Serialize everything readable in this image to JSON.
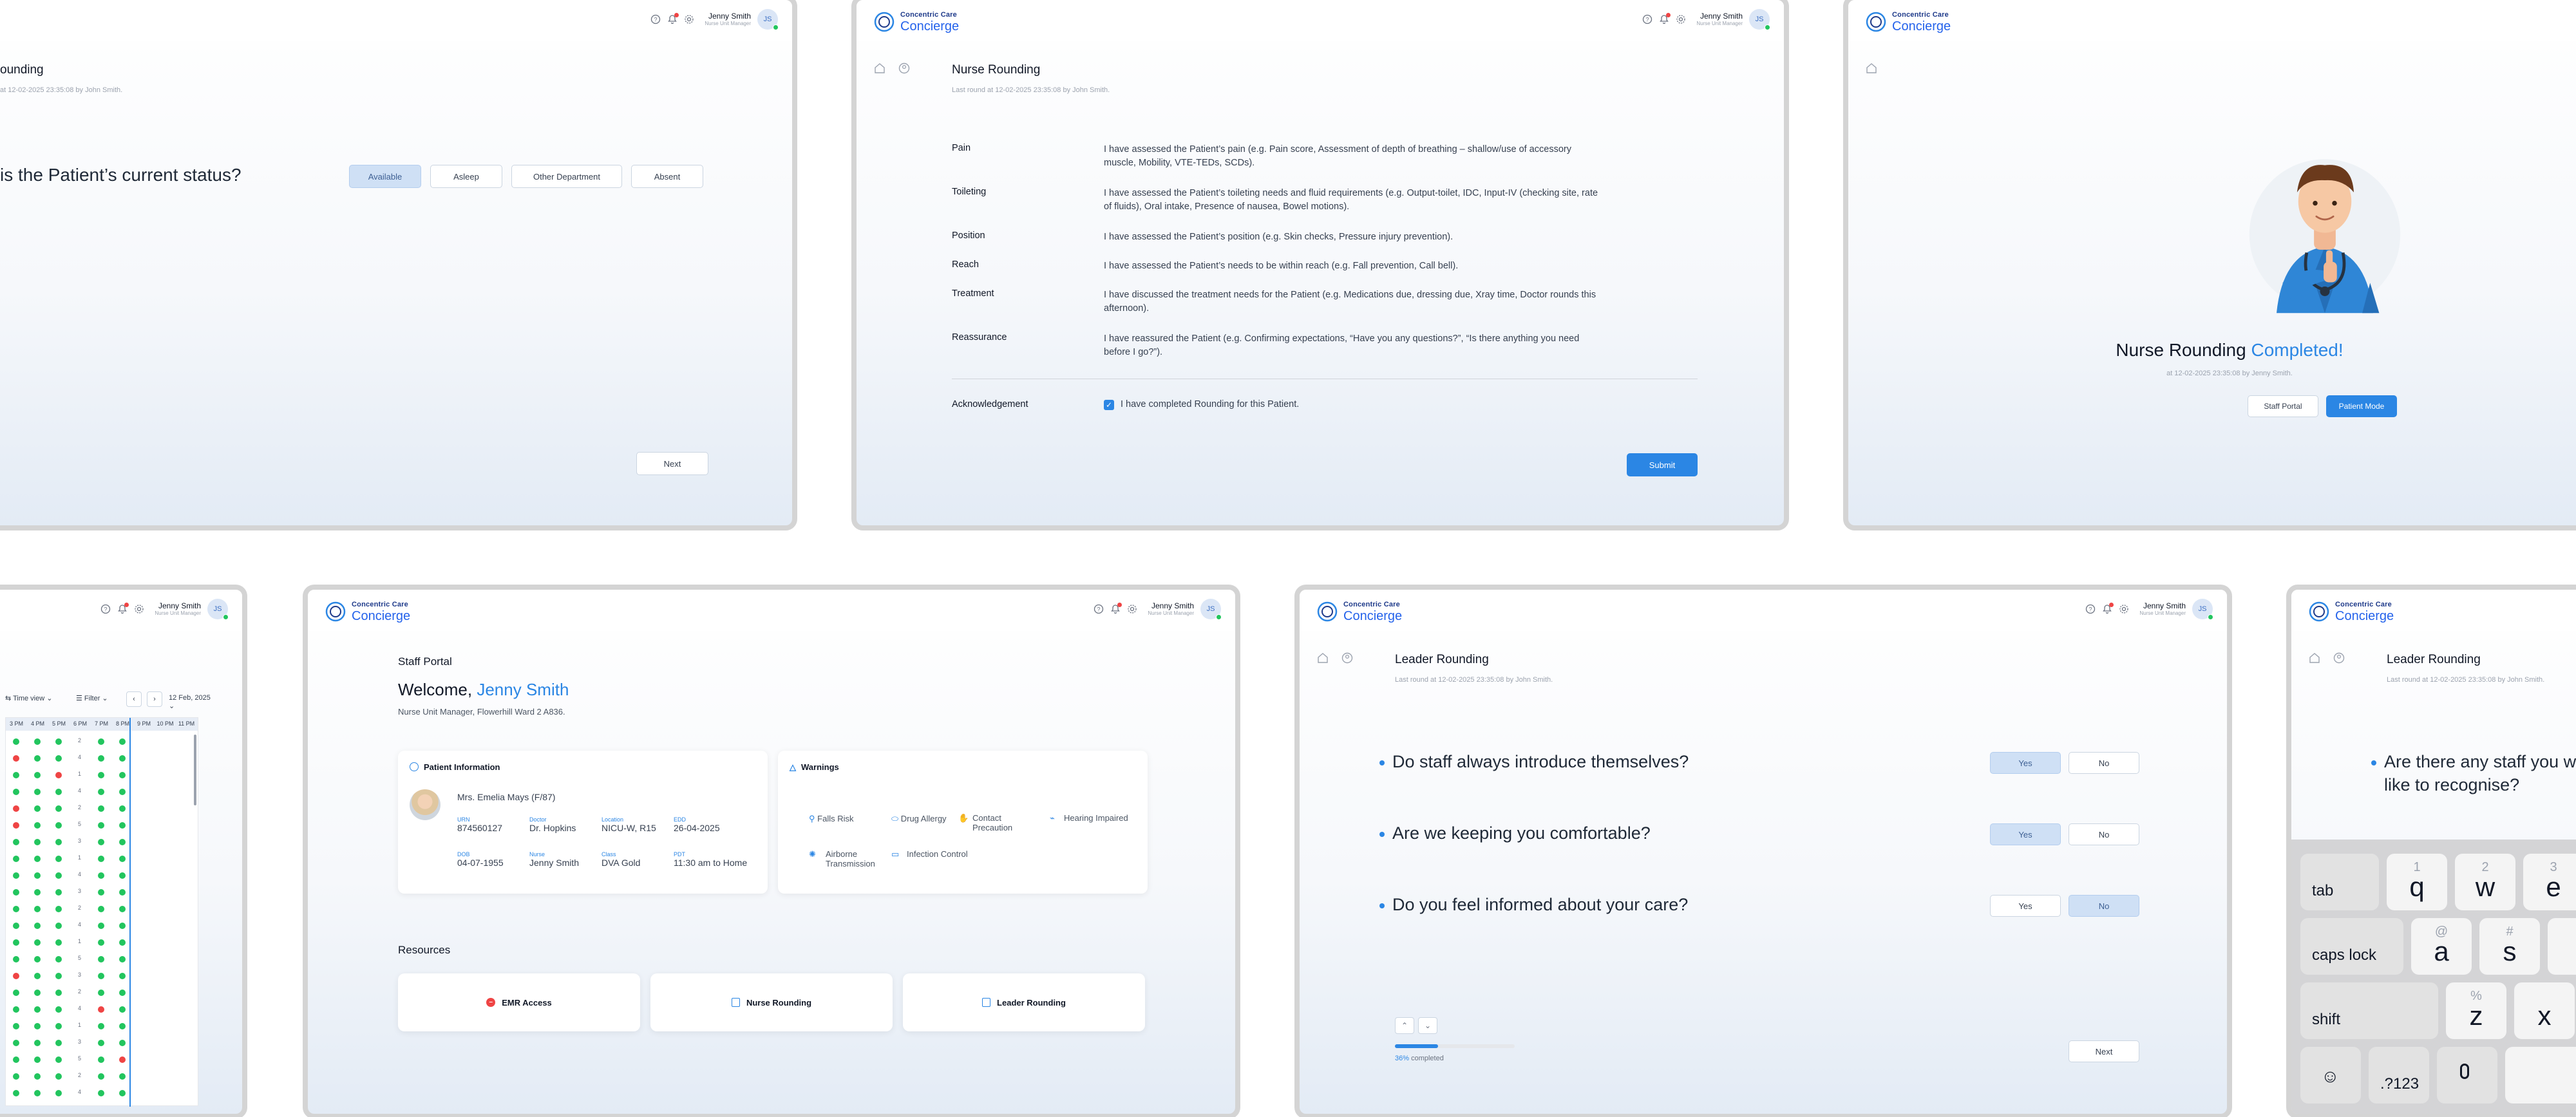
{
  "brand": {
    "top": "Concentric Care",
    "main": "Concierge"
  },
  "user": {
    "name": "Jenny Smith",
    "role": "Nurse Unit Manager",
    "initials": "JS"
  },
  "status_screen": {
    "title": "ounding",
    "last_round": "at 12-02-2025 23:35:08 by John Smith.",
    "question": "is the Patient’s current status?",
    "options": [
      "Available",
      "Asleep",
      "Other Department",
      "Absent"
    ],
    "selected": "Available",
    "next": "Next"
  },
  "nurse_rounding": {
    "title": "Nurse Rounding",
    "last_round": "Last round at 12-02-2025 23:35:08 by John Smith.",
    "items": [
      {
        "label": "Pain",
        "desc": "I have assessed the Patient’s pain (e.g. Pain score, Assessment of depth of breathing – shallow/use of accessory muscle, Mobility, VTE-TEDs, SCDs)."
      },
      {
        "label": "Toileting",
        "desc": "I have assessed the Patient’s toileting needs and fluid requirements (e.g. Output-toilet, IDC, Input-IV (checking site, rate of fluids), Oral intake, Presence of nausea, Bowel motions)."
      },
      {
        "label": "Position",
        "desc": "I have assessed the Patient’s position (e.g. Skin checks, Pressure injury prevention)."
      },
      {
        "label": "Reach",
        "desc": "I have assessed the Patient’s needs to be within reach (e.g. Fall prevention, Call bell)."
      },
      {
        "label": "Treatment",
        "desc": "I have discussed the treatment needs for the Patient (e.g. Medications due, dressing due, Xray time, Doctor rounds this afternoon)."
      },
      {
        "label": "Reassurance",
        "desc": "I have reassured the Patient (e.g. Confirming expectations, “Have you any questions?”, “Is there anything you need before I go?”)."
      }
    ],
    "ack_label": "Acknowledgement",
    "ack_text": "I have completed Rounding for this Patient.",
    "submit": "Submit"
  },
  "completed": {
    "title": "Nurse Rounding",
    "title_accent": "Completed!",
    "at": "at 12-02-2025 23:35:08 by Jenny Smith.",
    "btn_staff": "Staff Portal",
    "btn_patient": "Patient Mode"
  },
  "grid_screen": {
    "time_view": "Time view",
    "filter": "Filter",
    "date": "12 Feb, 2025",
    "hours": [
      "3 PM",
      "4 PM",
      "5 PM",
      "6 PM",
      "7 PM",
      "8 PM",
      "9 PM",
      "10 PM",
      "11 PM"
    ],
    "num_col": [
      "2",
      "4",
      "1",
      "4",
      "2",
      "5",
      "3",
      "1",
      "4",
      "3",
      "2",
      "4",
      "1",
      "5",
      "3",
      "2",
      "4",
      "1",
      "3",
      "5",
      "2",
      "4"
    ]
  },
  "staff_portal": {
    "section": "Staff Portal",
    "welcome": "Welcome,",
    "welcome_name": "Jenny Smith",
    "subtitle": "Nurse Unit Manager, Flowerhill Ward 2 A836.",
    "patient_info_title": "Patient Information",
    "patient_name": "Mrs. Emelia Mays (F/87)",
    "fields": [
      {
        "label": "URN",
        "value": "874560127"
      },
      {
        "label": "Doctor",
        "value": "Dr. Hopkins"
      },
      {
        "label": "Location",
        "value": "NICU-W, R15"
      },
      {
        "label": "EDD",
        "value": "26-04-2025"
      },
      {
        "label": "DOB",
        "value": "04-07-1955"
      },
      {
        "label": "Nurse",
        "value": "Jenny Smith"
      },
      {
        "label": "Class",
        "value": "DVA Gold"
      },
      {
        "label": "PDT",
        "value": "11:30 am to Home"
      }
    ],
    "warnings_title": "Warnings",
    "warnings": [
      "Falls Risk",
      "Drug Allergy",
      "Contact Precaution",
      "Hearing Impaired",
      "Airborne Transmission",
      "Infection Control"
    ],
    "resources_title": "Resources",
    "resources": [
      "EMR Access",
      "Nurse Rounding",
      "Leader Rounding"
    ]
  },
  "leader_rounding": {
    "title": "Leader Rounding",
    "last_round": "Last round at 12-02-2025 23:35:08 by John Smith.",
    "questions": [
      {
        "text": "Do staff always introduce themselves?",
        "selected": "Yes"
      },
      {
        "text": "Are we keeping you comfortable?",
        "selected": "Yes"
      },
      {
        "text": "Do you feel informed about your care?",
        "selected": "No"
      }
    ],
    "yes": "Yes",
    "no": "No",
    "progress_pct": "36%",
    "progress_value": 36,
    "progress_suffix": "completed",
    "next": "Next"
  },
  "leader_keyboard": {
    "title": "Leader Rounding",
    "last_round": "Last round at 12-02-2025 23:35:08 by John Smith.",
    "question_l1": "Are there any staff you w",
    "question_l2": "like to recognise?",
    "keys": {
      "tab": "tab",
      "caps": "caps lock",
      "shift": "shift",
      "num": ".?123",
      "q": "q",
      "w": "w",
      "e": "e",
      "a": "a",
      "s": "s",
      "z": "z",
      "x": "x",
      "q_alt": "1",
      "w_alt": "2",
      "e_alt": "3",
      "a_alt": "@",
      "s_alt": "#",
      "z_alt": "%"
    }
  }
}
